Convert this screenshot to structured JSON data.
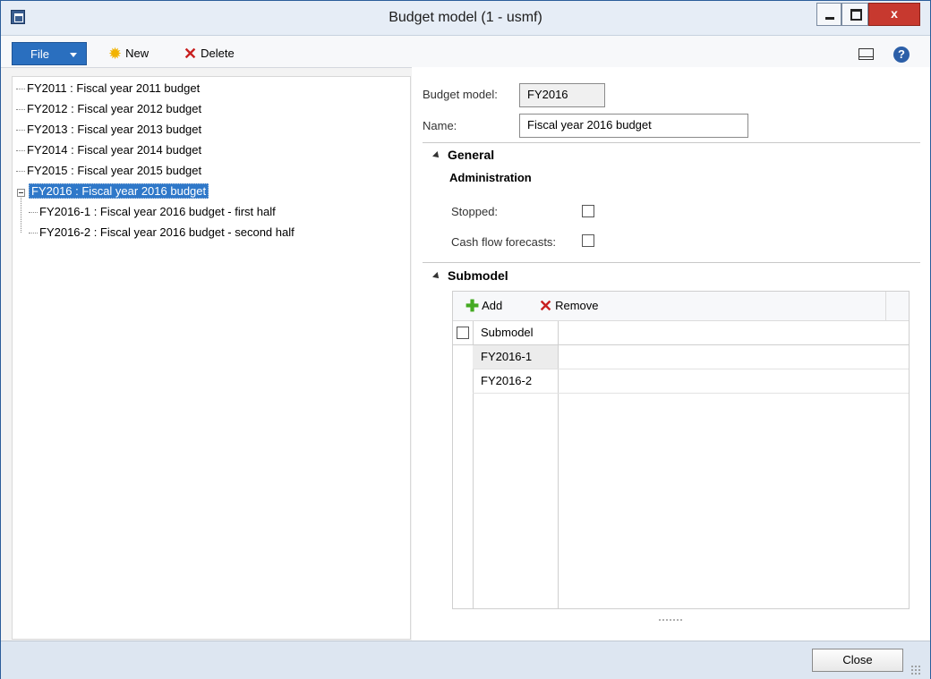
{
  "window": {
    "title": "Budget model (1 - usmf)",
    "close_glyph": "x"
  },
  "toolbar": {
    "file_label": "File",
    "new_label": "New",
    "delete_label": "Delete"
  },
  "tree": {
    "items": [
      {
        "label": "FY2011 : Fiscal year 2011 budget"
      },
      {
        "label": "FY2012 : Fiscal year 2012 budget"
      },
      {
        "label": "FY2013 : Fiscal year 2013 budget"
      },
      {
        "label": "FY2014 : Fiscal year 2014 budget"
      },
      {
        "label": "FY2015 : Fiscal year 2015 budget"
      },
      {
        "label": "FY2016 : Fiscal year 2016 budget",
        "selected": true,
        "expanded": true
      },
      {
        "label": "FY2016-1 : Fiscal year 2016 budget - first half"
      },
      {
        "label": "FY2016-2 : Fiscal year 2016 budget - second half"
      }
    ]
  },
  "detail": {
    "budget_model_label": "Budget model:",
    "budget_model_value": "FY2016",
    "name_label": "Name:",
    "name_value": "Fiscal year 2016 budget"
  },
  "general": {
    "title": "General",
    "subtitle": "Administration",
    "stopped_label": "Stopped:",
    "stopped_checked": false,
    "cashflow_label": "Cash flow forecasts:",
    "cashflow_checked": false
  },
  "submodel": {
    "title": "Submodel",
    "add_label": "Add",
    "remove_label": "Remove",
    "column_header": "Submodel",
    "rows": [
      "FY2016-1",
      "FY2016-2"
    ]
  },
  "footer": {
    "close_label": "Close"
  },
  "colors": {
    "accent": "#2a6fbf",
    "selection": "#2f78c9",
    "window_border": "#2b5d9a",
    "status_bar": "#dde6f1"
  }
}
